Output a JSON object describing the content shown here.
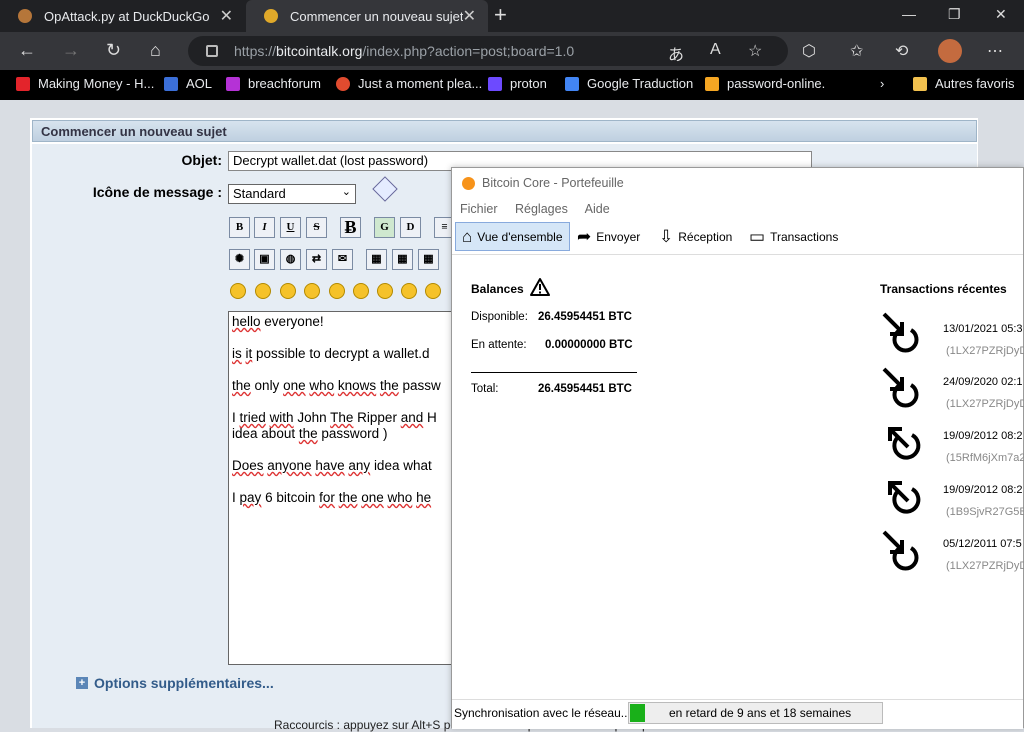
{
  "browser": {
    "tabs": [
      {
        "label": "OpAttack.py at DuckDuckGo"
      },
      {
        "label": "Commencer un nouveau sujet"
      }
    ],
    "url_prefix": "https://",
    "url_host": "bitcointalk.org",
    "url_path": "/index.php?action=post;board=1.0",
    "bookmarks": [
      {
        "label": "Making Money - H...",
        "color": "#e3242b"
      },
      {
        "label": "AOL",
        "color": "#3b6fd8"
      },
      {
        "label": "breachforum",
        "color": "#b532d6"
      },
      {
        "label": "Just a moment plea...",
        "color": "#e04b2f"
      },
      {
        "label": "proton",
        "color": "#6d4aff"
      },
      {
        "label": "Google Traduction",
        "color": "#4285f4"
      },
      {
        "label": "password-online.",
        "color": "#f5a623"
      }
    ],
    "bookmarks_other": "Autres favoris"
  },
  "page": {
    "header": "Commencer un nouveau sujet",
    "subject_label": "Objet:",
    "subject_value": "Decrypt wallet.dat (lost password)",
    "icon_label": "Icône de message :",
    "icon_value": "Standard",
    "toolbar_text": [
      "B",
      "I",
      "U",
      "S",
      "Ƀ",
      "G",
      "D"
    ],
    "message_lines": [
      "hello everyone!",
      "is it possible to decrypt a wallet.d",
      "the only one who knows the passw",
      "I tried with John The Ripper and H",
      "idea about the password )",
      "Does anyone have any idea what",
      "I pay 6 bitcoin for the one who he"
    ],
    "options": "Options supplémentaires...",
    "shortcut": "Raccourcis : appuyez sur Alt+S pour soumettre/publier ou alt+P pour prévisualiser"
  },
  "wallet": {
    "title": "Bitcoin Core - Portefeuille",
    "menu": [
      "Fichier",
      "Réglages",
      "Aide"
    ],
    "tabs": [
      "Vue d'ensemble",
      "Envoyer",
      "Réception",
      "Transactions"
    ],
    "balances_title": "Balances",
    "available_label": "Disponible:",
    "available_value": "26.45954451 BTC",
    "pending_label": "En attente:",
    "pending_value": "0.00000000 BTC",
    "total_label": "Total:",
    "total_value": "26.45954451 BTC",
    "recent_title": "Transactions récentes",
    "transactions": [
      {
        "date": "13/01/2021 05:3",
        "address": "(1LX27PZRjDyDr",
        "direction": "in"
      },
      {
        "date": "24/09/2020 02:1",
        "address": "(1LX27PZRjDyDr",
        "direction": "in"
      },
      {
        "date": "19/09/2012 08:2",
        "address": "(15RfM6jXm7a2",
        "direction": "out"
      },
      {
        "date": "19/09/2012 08:2",
        "address": "(1B9SjvR27G5B",
        "direction": "out"
      },
      {
        "date": "05/12/2011 07:5",
        "address": "(1LX27PZRjDyDr",
        "direction": "in"
      }
    ],
    "status_text": "Synchronisation avec le réseau...",
    "progress_text": "en retard de 9 ans et 18 semaines",
    "progress": 0.06
  }
}
